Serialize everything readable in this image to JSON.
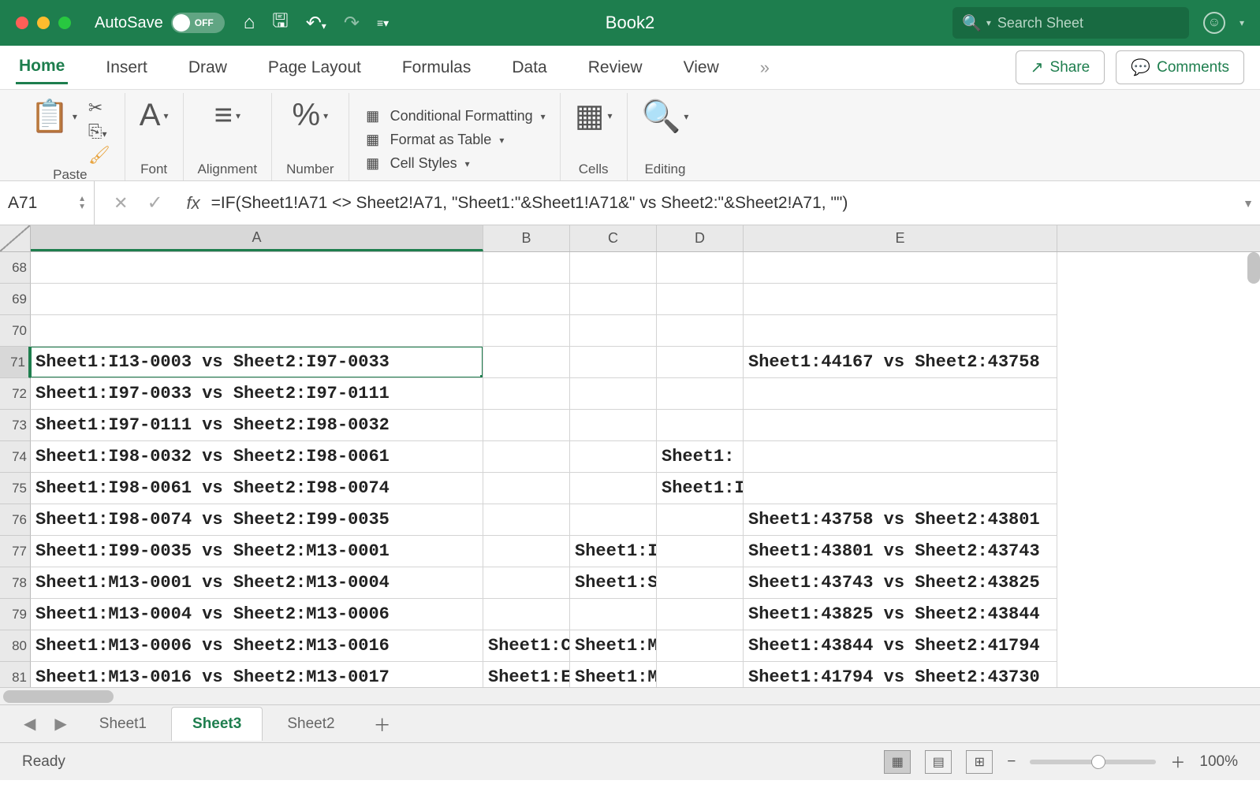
{
  "titlebar": {
    "autosave_label": "AutoSave",
    "autosave_state": "OFF",
    "doc_title": "Book2",
    "search_placeholder": "Search Sheet"
  },
  "ribbon_tabs": {
    "items": [
      "Home",
      "Insert",
      "Draw",
      "Page Layout",
      "Formulas",
      "Data",
      "Review",
      "View"
    ],
    "active": "Home",
    "share": "Share",
    "comments": "Comments"
  },
  "ribbon_groups": {
    "paste": "Paste",
    "font": "Font",
    "alignment": "Alignment",
    "number": "Number",
    "cond_fmt": "Conditional Formatting",
    "fmt_table": "Format as Table",
    "cell_styles": "Cell Styles",
    "cells": "Cells",
    "editing": "Editing"
  },
  "formula_bar": {
    "cell_ref": "A71",
    "formula": "=IF(Sheet1!A71 <> Sheet2!A71, \"Sheet1:\"&Sheet1!A71&\" vs Sheet2:\"&Sheet2!A71, \"\")"
  },
  "columns": [
    "A",
    "B",
    "C",
    "D",
    "E"
  ],
  "rows": [
    {
      "n": 68,
      "A": "",
      "B": "",
      "C": "",
      "D": "",
      "E": ""
    },
    {
      "n": 69,
      "A": "",
      "B": "",
      "C": "",
      "D": "",
      "E": ""
    },
    {
      "n": 70,
      "A": "",
      "B": "",
      "C": "",
      "D": "",
      "E": ""
    },
    {
      "n": 71,
      "A": "Sheet1:I13-0003 vs Sheet2:I97-0033",
      "B": "",
      "C": "",
      "D": "",
      "E": "Sheet1:44167 vs Sheet2:43758"
    },
    {
      "n": 72,
      "A": "Sheet1:I97-0033 vs Sheet2:I97-0111",
      "B": "",
      "C": "",
      "D": "",
      "E": ""
    },
    {
      "n": 73,
      "A": "Sheet1:I97-0111 vs Sheet2:I98-0032",
      "B": "",
      "C": "",
      "D": "",
      "E": ""
    },
    {
      "n": 74,
      "A": "Sheet1:I98-0032 vs Sheet2:I98-0061",
      "B": "",
      "C": "",
      "D": "Sheet1:",
      "E": ""
    },
    {
      "n": 75,
      "A": "Sheet1:I98-0061 vs Sheet2:I98-0074",
      "B": "",
      "C": "",
      "D": "Sheet1:I",
      "E": ""
    },
    {
      "n": 76,
      "A": "Sheet1:I98-0074 vs Sheet2:I99-0035",
      "B": "",
      "C": "",
      "D": "",
      "E": "Sheet1:43758 vs Sheet2:43801"
    },
    {
      "n": 77,
      "A": "Sheet1:I99-0035 vs Sheet2:M13-0001",
      "B": "",
      "C": "Sheet1:I",
      "D": "",
      "E": "Sheet1:43801 vs Sheet2:43743"
    },
    {
      "n": 78,
      "A": "Sheet1:M13-0001 vs Sheet2:M13-0004",
      "B": "",
      "C": "Sheet1:S",
      "D": "",
      "E": "Sheet1:43743 vs Sheet2:43825"
    },
    {
      "n": 79,
      "A": "Sheet1:M13-0004 vs Sheet2:M13-0006",
      "B": "",
      "C": "",
      "D": "",
      "E": "Sheet1:43825 vs Sheet2:43844"
    },
    {
      "n": 80,
      "A": "Sheet1:M13-0006 vs Sheet2:M13-0016",
      "B": "Sheet1:C",
      "C": "Sheet1:M",
      "D": "",
      "E": "Sheet1:43844 vs Sheet2:41794"
    },
    {
      "n": 81,
      "A": "Sheet1:M13-0016 vs Sheet2:M13-0017",
      "B": "Sheet1:E",
      "C": "Sheet1:M",
      "D": "",
      "E": "Sheet1:41794 vs Sheet2:43730"
    }
  ],
  "selected_row": 71,
  "sheet_tabs": {
    "items": [
      "Sheet1",
      "Sheet3",
      "Sheet2"
    ],
    "active": "Sheet3"
  },
  "status": {
    "ready": "Ready",
    "zoom": "100%"
  }
}
